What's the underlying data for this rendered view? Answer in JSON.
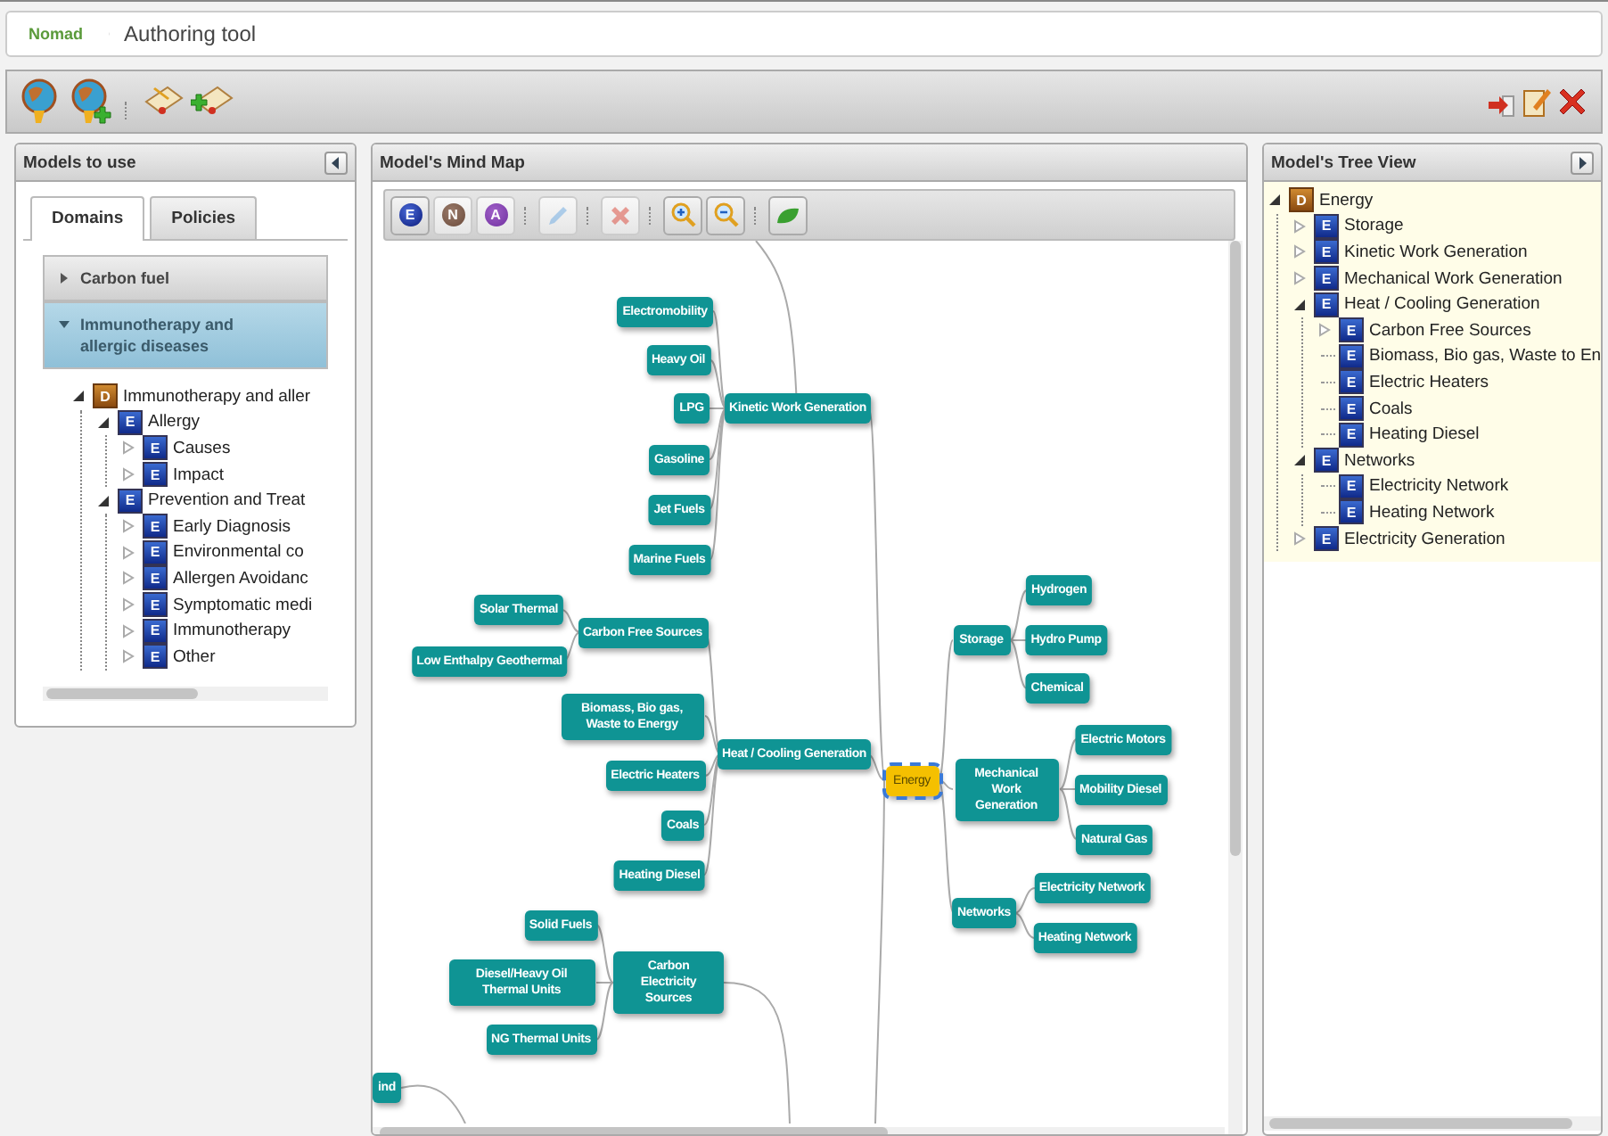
{
  "header": {
    "brand": "Nomad",
    "title": "Authoring tool"
  },
  "toolbar": {
    "left_groups": [
      [
        {
          "kind": "globe"
        },
        {
          "kind": "globe_add"
        }
      ],
      [
        {
          "kind": "scroll_edit"
        },
        {
          "kind": "scroll_add"
        }
      ]
    ],
    "right": [
      {
        "kind": "export"
      },
      {
        "kind": "edit_doc"
      },
      {
        "kind": "close"
      }
    ]
  },
  "models_panel": {
    "title": "Models to use",
    "tabs": [
      {
        "label": "Domains",
        "selected": true
      },
      {
        "label": "Policies",
        "selected": false
      }
    ],
    "accordion": [
      {
        "label": "Carbon fuel",
        "expanded": false
      },
      {
        "label": "Immunotherapy and allergic diseases",
        "expanded": true,
        "tree": [
          {
            "badge": "D",
            "kind": "domain",
            "label": "Immunotherapy and aller",
            "expanded": true,
            "children": [
              {
                "badge": "E",
                "kind": "element",
                "label": "Allergy",
                "expanded": true,
                "children": [
                  {
                    "badge": "E",
                    "kind": "element",
                    "label": "Causes",
                    "expanded": false
                  },
                  {
                    "badge": "E",
                    "kind": "element",
                    "label": "Impact",
                    "expanded": false
                  }
                ]
              },
              {
                "badge": "E",
                "kind": "element",
                "label": "Prevention and Treat",
                "expanded": true,
                "children": [
                  {
                    "badge": "E",
                    "kind": "element",
                    "label": "Early Diagnosis",
                    "expanded": false
                  },
                  {
                    "badge": "E",
                    "kind": "element",
                    "label": "Environmental co",
                    "expanded": false
                  },
                  {
                    "badge": "E",
                    "kind": "element",
                    "label": "Allergen Avoidanc",
                    "expanded": false
                  },
                  {
                    "badge": "E",
                    "kind": "element",
                    "label": "Symptomatic medi",
                    "expanded": false
                  },
                  {
                    "badge": "E",
                    "kind": "element",
                    "label": "Immunotherapy",
                    "expanded": false
                  },
                  {
                    "badge": "E",
                    "kind": "element",
                    "label": "Other",
                    "expanded": false
                  }
                ]
              }
            ]
          }
        ]
      }
    ]
  },
  "mind_map_panel": {
    "title": "Model's Mind Map",
    "toolbar": [
      [
        {
          "kind": "letter",
          "label": "E",
          "disabled": false
        },
        {
          "kind": "letter",
          "label": "N",
          "disabled": true
        },
        {
          "kind": "letter",
          "label": "A",
          "disabled": true
        }
      ],
      [
        {
          "kind": "pencil",
          "disabled": true
        }
      ],
      [
        {
          "kind": "delete",
          "disabled": true
        }
      ],
      [
        {
          "kind": "zoom_in",
          "disabled": false
        },
        {
          "kind": "zoom_out",
          "disabled": false
        }
      ],
      [
        {
          "kind": "leaf",
          "disabled": false
        }
      ]
    ],
    "nodes": [
      {
        "label": "Energy",
        "kind": "root",
        "selected": true,
        "children": [
          {
            "label": "Kinetic Work Generation",
            "kind": "branch",
            "selected": false,
            "children": [
              {
                "label": "Electromobility",
                "kind": "branch",
                "selected": false
              },
              {
                "label": "Heavy Oil",
                "kind": "branch",
                "selected": false
              },
              {
                "label": "LPG",
                "kind": "branch",
                "selected": false
              },
              {
                "label": "Gasoline",
                "kind": "branch",
                "selected": false
              },
              {
                "label": "Jet Fuels",
                "kind": "branch",
                "selected": false
              },
              {
                "label": "Marine Fuels",
                "kind": "branch",
                "selected": false
              }
            ]
          },
          {
            "label": "Heat / Cooling Generation",
            "kind": "branch",
            "selected": false,
            "children": [
              {
                "label": "Carbon Free Sources",
                "kind": "branch",
                "selected": false,
                "children": [
                  {
                    "label": "Solar Thermal",
                    "kind": "branch",
                    "selected": false
                  },
                  {
                    "label": "Low Enthalpy Geothermal",
                    "kind": "branch",
                    "selected": false
                  }
                ]
              },
              {
                "label": "Biomass, Bio gas, Waste to Energy",
                "kind": "branch",
                "selected": false
              },
              {
                "label": "Electric Heaters",
                "kind": "branch",
                "selected": false
              },
              {
                "label": "Coals",
                "kind": "branch",
                "selected": false
              },
              {
                "label": "Heating Diesel",
                "kind": "branch",
                "selected": false
              }
            ]
          },
          {
            "label": "Storage",
            "kind": "branch",
            "selected": false,
            "children": [
              {
                "label": "Hydrogen",
                "kind": "branch",
                "selected": false
              },
              {
                "label": "Hydro Pump",
                "kind": "branch",
                "selected": false
              },
              {
                "label": "Chemical",
                "kind": "branch",
                "selected": false
              }
            ]
          },
          {
            "label": "Mechanical Work Generation",
            "kind": "branch",
            "selected": false,
            "children": [
              {
                "label": "Electric Motors",
                "kind": "branch",
                "selected": false
              },
              {
                "label": "Mobility Diesel",
                "kind": "branch",
                "selected": false
              },
              {
                "label": "Natural Gas",
                "kind": "branch",
                "selected": false
              }
            ]
          },
          {
            "label": "Networks",
            "kind": "branch",
            "selected": false,
            "children": [
              {
                "label": "Electricity Network",
                "kind": "branch",
                "selected": false
              },
              {
                "label": "Heating Network",
                "kind": "branch",
                "selected": false
              }
            ]
          }
        ]
      },
      {
        "label": "Carbon Electricity Sources",
        "kind": "branch",
        "selected": false,
        "children": [
          {
            "label": "Solid Fuels",
            "kind": "branch",
            "selected": false
          },
          {
            "label": "Diesel/Heavy Oil Thermal Units",
            "kind": "branch",
            "selected": false
          },
          {
            "label": "NG Thermal Units",
            "kind": "branch",
            "selected": false
          }
        ]
      },
      {
        "label": "ind",
        "kind": "branch",
        "selected": false
      }
    ]
  },
  "tree_panel": {
    "title": "Model's Tree View",
    "tree": [
      {
        "badge": "D",
        "kind": "domain",
        "label": "Energy",
        "expanded": true,
        "children": [
          {
            "badge": "E",
            "kind": "element",
            "label": "Storage",
            "expanded": false
          },
          {
            "badge": "E",
            "kind": "element",
            "label": "Kinetic Work Generation",
            "expanded": false
          },
          {
            "badge": "E",
            "kind": "element",
            "label": "Mechanical Work Generation",
            "expanded": false
          },
          {
            "badge": "E",
            "kind": "element",
            "label": "Heat / Cooling Generation",
            "expanded": true,
            "children": [
              {
                "badge": "E",
                "kind": "element",
                "label": "Carbon Free Sources",
                "expanded": false
              },
              {
                "badge": "E",
                "kind": "element",
                "label": "Biomass, Bio gas, Waste to En"
              },
              {
                "badge": "E",
                "kind": "element",
                "label": "Electric Heaters"
              },
              {
                "badge": "E",
                "kind": "element",
                "label": "Coals"
              },
              {
                "badge": "E",
                "kind": "element",
                "label": "Heating Diesel"
              }
            ]
          },
          {
            "badge": "E",
            "kind": "element",
            "label": "Networks",
            "expanded": true,
            "children": [
              {
                "badge": "E",
                "kind": "element",
                "label": "Electricity Network"
              },
              {
                "badge": "E",
                "kind": "element",
                "label": "Heating Network"
              }
            ]
          },
          {
            "badge": "E",
            "kind": "element",
            "label": "Electricity Generation",
            "expanded": false
          }
        ]
      }
    ]
  }
}
